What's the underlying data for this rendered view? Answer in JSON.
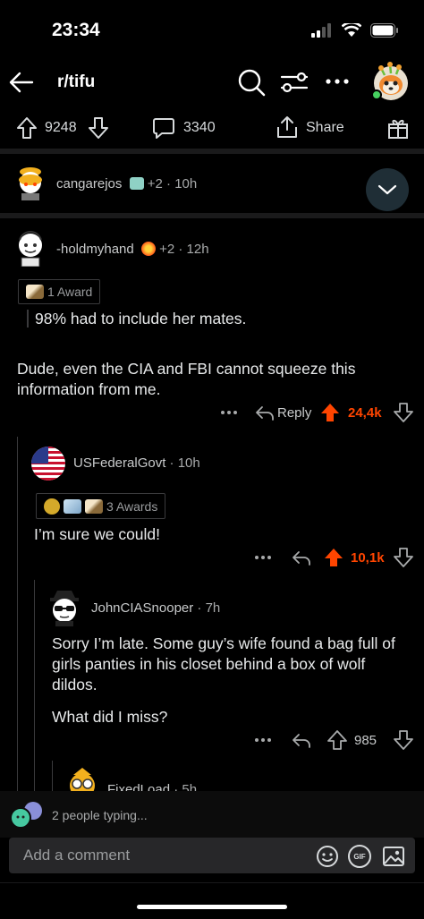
{
  "status": {
    "time": "23:34"
  },
  "header": {
    "subreddit": "r/tifu"
  },
  "post_actions": {
    "upvotes": "9248",
    "comments": "3340",
    "share_label": "Share"
  },
  "collapsed_comment": {
    "username": "cangarejos",
    "extra_awards": "+2",
    "time": "10h"
  },
  "comments": [
    {
      "username": "-holdmyhand",
      "extra_awards": "+2",
      "time": "12h",
      "award_label": "1 Award",
      "quote": "98% had to include her mates.",
      "text": "Dude, even the CIA and FBI cannot squeeze this information from me.",
      "reply_label": "Reply",
      "votes": "24,4k"
    },
    {
      "username": "USFederalGovt",
      "time": "10h",
      "award_label": "3 Awards",
      "text": "I’m sure we could!",
      "votes": "10,1k"
    },
    {
      "username": "JohnCIASnooper",
      "time": "7h",
      "text_p1": "Sorry I’m late.  Some guy’s wife found a bag full of girls panties in his closet behind a box of wolf dildos.",
      "text_p2": "What did I miss?",
      "votes": "985"
    },
    {
      "username": "FixedLoad",
      "time": "5h"
    }
  ],
  "footer": {
    "typing": "2 people typing...",
    "comment_placeholder": "Add a comment",
    "gif_label": "GIF"
  },
  "colors": {
    "upvote_active": "#ff4500",
    "background": "#000000",
    "accent_button": "#1f2e36"
  }
}
